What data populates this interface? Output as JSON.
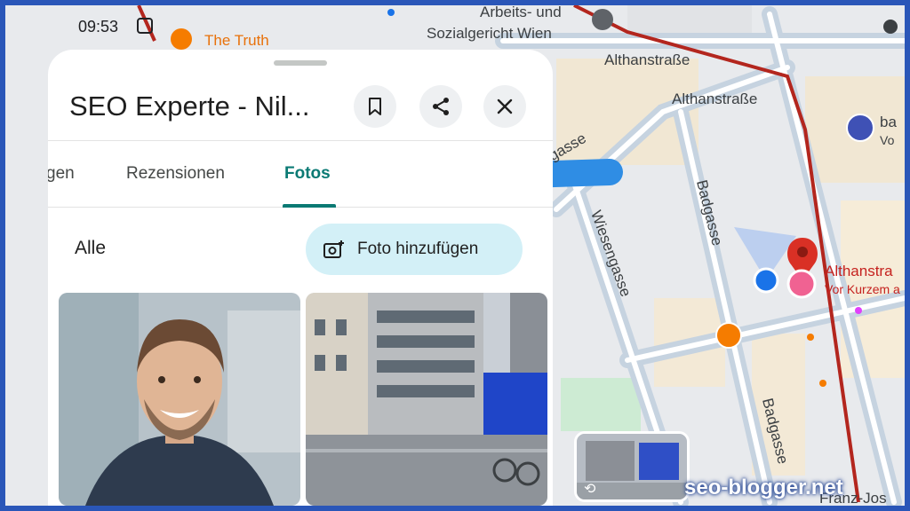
{
  "status_bar": {
    "time": "09:53"
  },
  "place": {
    "title": "SEO Experte - Nil...",
    "tabs": [
      {
        "label": "gen"
      },
      {
        "label": "Rezensionen"
      },
      {
        "label": "Fotos"
      }
    ],
    "active_tab": "Fotos",
    "filter_label": "Alle",
    "add_photo_label": "Foto hinzufügen"
  },
  "map": {
    "labels": {
      "the_truth": "The Truth",
      "court_line1": "Arbeits- und",
      "court_line2": "Sozialgericht Wien",
      "althan1": "Althanstraße",
      "althan2": "Althanstraße",
      "althan3": "Althanstra",
      "vor_kurzem": "Vor Kurzem a",
      "ba": "ba",
      "vo": "Vo",
      "gasse": "gasse",
      "wiesengasse": "Wiesengasse",
      "badgasse1": "Badgasse",
      "badgasse2": "Badgasse",
      "franz": "Franz-Jos"
    }
  },
  "watermark": {
    "text": "seo-blogger.net"
  },
  "colors": {
    "accent_teal": "#0b7a74",
    "arrow_blue": "#2f8de4",
    "pin_red": "#d93025",
    "location_blue": "#1a73e8",
    "tram_red": "#b3261e",
    "frame_blue": "#2a56b8"
  }
}
